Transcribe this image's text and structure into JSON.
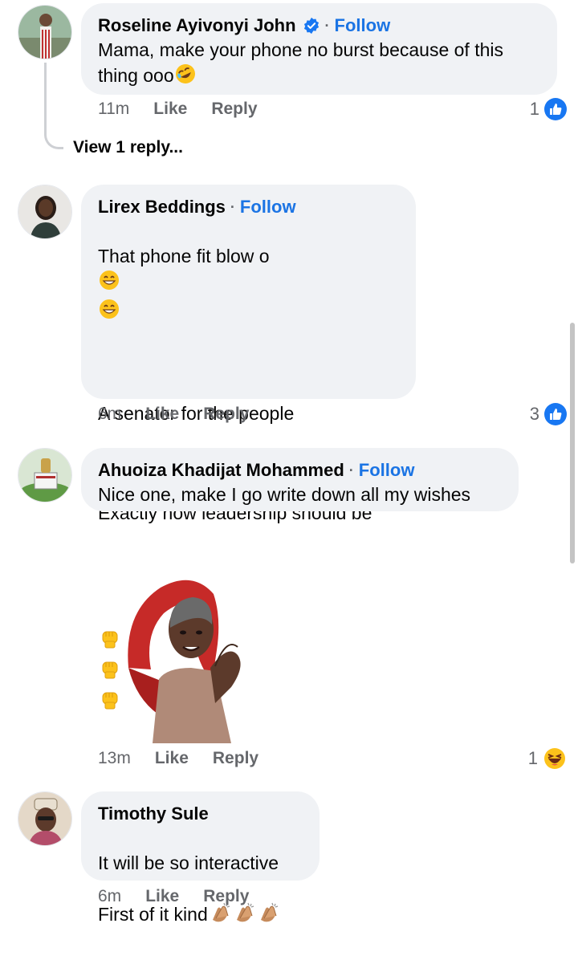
{
  "comments": [
    {
      "name": "Roseline Ayivonyi John",
      "verified": true,
      "follow_label": "Follow",
      "text": "Mama, make your phone no burst because of this thing ooo",
      "time": "11m",
      "like_label": "Like",
      "reply_label": "Reply",
      "reaction_count": "1",
      "reaction_type": "like-icon"
    },
    {
      "name": "Lirex Beddings",
      "follow_label": "Follow",
      "line1": "That phone fit blow o",
      "line2": "A senator for the people",
      "line3": "Exactly how leadership should be",
      "time": "6m",
      "like_label": "Like",
      "reply_label": "Reply",
      "reaction_count": "3",
      "reaction_type": "like-icon"
    },
    {
      "name": "Ahuoiza Khadijat Mohammed",
      "follow_label": "Follow",
      "text": "Nice one, make I go write down all my wishes",
      "time": "13m",
      "like_label": "Like",
      "reply_label": "Reply",
      "reaction_count": "1",
      "reaction_type": "haha-icon"
    },
    {
      "name": "Timothy Sule",
      "line1": "It will be so interactive",
      "line2": "First of it kind",
      "time": "6m",
      "like_label": "Like",
      "reply_label": "Reply"
    }
  ],
  "view_replies": "View 1 reply...",
  "colors": {
    "accent": "#1b74e4",
    "bubble": "#f0f2f5",
    "meta": "#65676b"
  }
}
